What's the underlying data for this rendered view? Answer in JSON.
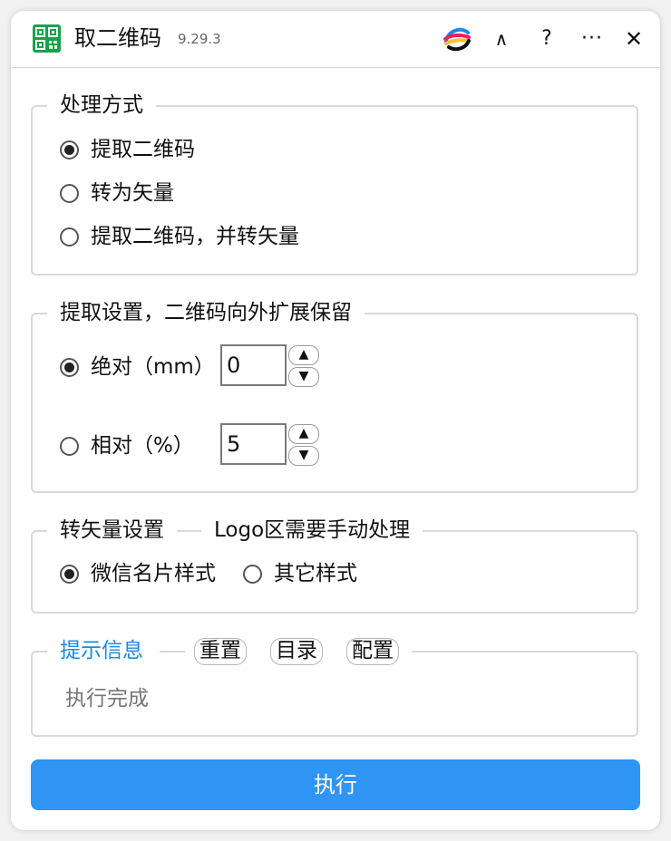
{
  "app": {
    "title": "取二维码",
    "version": "9.29.3",
    "controls": {
      "logo_icon": "multicolor-swirl-logo-icon",
      "up": "∧",
      "help": "?",
      "more": "···",
      "close": "✕"
    }
  },
  "mode_group": {
    "legend": "处理方式",
    "options": [
      "提取二维码",
      "转为矢量",
      "提取二维码，并转矢量"
    ],
    "selected_index": 0
  },
  "extract_group": {
    "legend": "提取设置，二维码向外扩展保留",
    "absolute": {
      "label": "绝对（mm）",
      "value": "0",
      "selected": true
    },
    "relative": {
      "label": "相对（%）",
      "value": "5",
      "selected": false
    },
    "spin_up": "▲",
    "spin_down": "▼"
  },
  "vector_group": {
    "legend": "转矢量设置",
    "note": "Logo区需要手动处理",
    "options": [
      "微信名片样式",
      "其它样式"
    ],
    "selected_index": 0
  },
  "info_group": {
    "legend": "提示信息",
    "buttons": {
      "reset": "重置",
      "directory": "目录",
      "config": "配置"
    },
    "message": "执行完成"
  },
  "run_button": "执行",
  "colors": {
    "accent": "#2e95f5",
    "legend_link": "#1a8ae0",
    "qr_green": "#17a24a"
  }
}
